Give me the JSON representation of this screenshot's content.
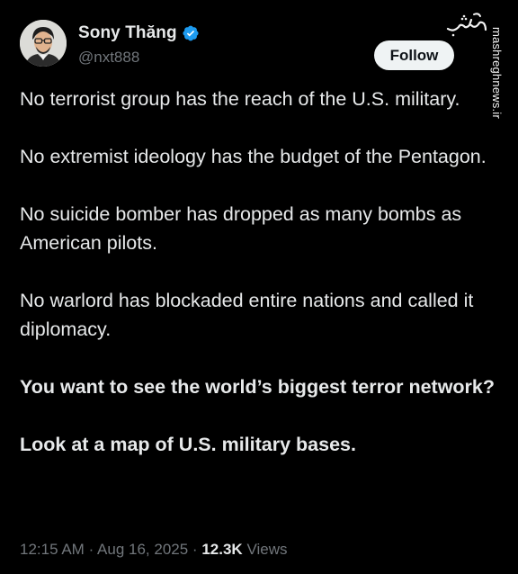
{
  "author": {
    "display_name": "Sony Thăng",
    "handle": "@nxt888",
    "verified": true
  },
  "follow_button": {
    "label": "Follow"
  },
  "watermark": {
    "url": "mashreghnews.ir",
    "logo_icon": "mashregh-logo"
  },
  "post": {
    "paragraphs": [
      "No terrorist group has the reach of the U.S. military.",
      "No extremist ideology has the budget of the Pentagon.",
      "No suicide bomber has dropped as many bombs as American pilots.",
      "No warlord has blockaded entire nations and called it diplomacy.",
      "You want to see the world’s biggest terror network?",
      "Look at a map of U.S. military bases."
    ]
  },
  "meta": {
    "time": "12:15 AM",
    "separator": "·",
    "date": "Aug 16, 2025",
    "views_count": "12.3K",
    "views_label": "Views"
  },
  "colors": {
    "background": "#000000",
    "text": "#e7e9ea",
    "muted": "#71767b",
    "verified_blue": "#1d9bf0",
    "follow_bg": "#eff3f4"
  }
}
